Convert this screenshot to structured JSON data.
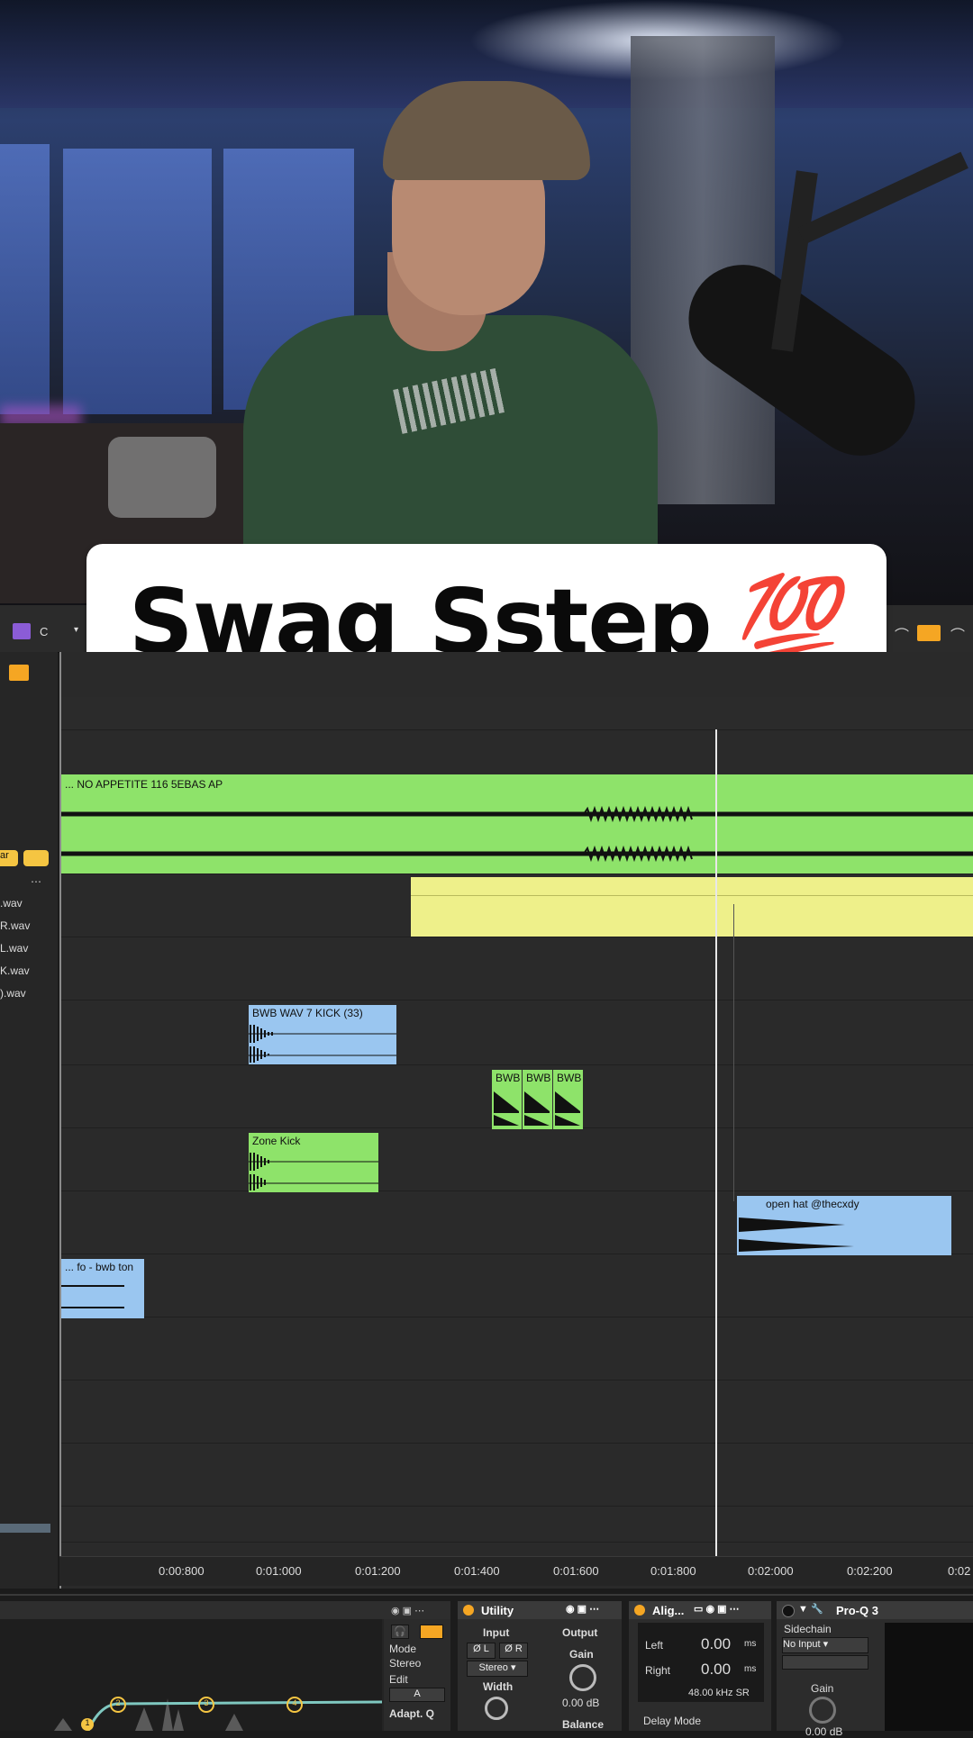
{
  "caption": {
    "text": "Swag Sstep",
    "emoji": "💯"
  },
  "toolbar": {
    "key_value": "C"
  },
  "browser": {
    "files": [
      ".wav",
      "R.wav",
      "L.wav",
      "K.wav",
      ").wav"
    ],
    "tag_chip": "ar"
  },
  "clips": {
    "main": "... NO APPETITE 116 5EBAS AP",
    "kick": "BWB WAV 7 KICK (33)",
    "bwb1": "BWB",
    "bwb2": "BWB",
    "bwb3": "BWB",
    "zone_kick": "Zone Kick",
    "open_hat": "open hat @thecxdy",
    "fo_bwb": "... fo - bwb ton"
  },
  "ruler": {
    "ticks": [
      "0:00:800",
      "0:01:000",
      "0:01:200",
      "0:01:400",
      "0:01:600",
      "0:01:800",
      "0:02:000",
      "0:02:200",
      "0:02"
    ]
  },
  "devices": {
    "eq": {
      "mode_label": "Mode",
      "mode_value": "Stereo",
      "edit_label": "Edit",
      "edit_value": "A",
      "adapt_label": "Adapt. Q",
      "band_numbers": [
        "1",
        "2",
        "3",
        "4"
      ]
    },
    "utility": {
      "title": "Utility",
      "input": "Input",
      "output": "Output",
      "phase_l": "Ø L",
      "phase_r": "Ø R",
      "stereo": "Stereo",
      "width": "Width",
      "gain": "Gain",
      "gain_value": "0.00 dB",
      "balance": "Balance"
    },
    "align": {
      "title": "Alig...",
      "left": "Left",
      "left_value": "0.00",
      "right": "Right",
      "right_value": "0.00",
      "unit": "ms",
      "sr": "48.00 kHz SR",
      "delay_mode": "Delay Mode"
    },
    "proq": {
      "title": "Pro-Q 3",
      "sidechain": "Sidechain",
      "no_input": "No Input",
      "gain": "Gain",
      "gain_value": "0.00 dB"
    }
  },
  "colors": {
    "green_clip": "#8ee36a",
    "yellow_clip": "#eef08a",
    "blue_clip": "#9ac6f0",
    "accent_orange": "#f5a623"
  }
}
